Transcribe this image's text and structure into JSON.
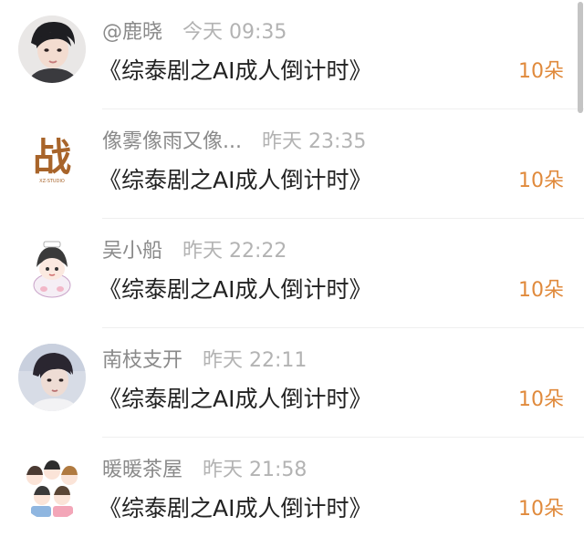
{
  "items": [
    {
      "username": "@鹿晓",
      "time": "今天 09:35",
      "gift": "《综泰剧之AI成人倒计时》",
      "amount": "10朵",
      "avatar_icon": "male-portrait-avatar"
    },
    {
      "username": "像雾像雨又像...",
      "time": "昨天 23:35",
      "gift": "《综泰剧之AI成人倒计时》",
      "amount": "10朵",
      "avatar_icon": "calligraphy-zhan-logo-avatar"
    },
    {
      "username": "吴小船",
      "time": "昨天 22:22",
      "gift": "《综泰剧之AI成人倒计时》",
      "amount": "10朵",
      "avatar_icon": "cartoon-chibi-avatar"
    },
    {
      "username": "南枝支开",
      "time": "昨天 22:11",
      "gift": "《综泰剧之AI成人倒计时》",
      "amount": "10朵",
      "avatar_icon": "male-portrait-avatar"
    },
    {
      "username": "暖暖茶屋",
      "time": "昨天 21:58",
      "gift": "《综泰剧之AI成人倒计时》",
      "amount": "10朵",
      "avatar_icon": "cartoon-group-avatar"
    }
  ],
  "avatar_logo_text": "战",
  "avatar_logo_subtext": "XZ-STUDIO",
  "colors": {
    "amount": "#e08a3c",
    "username": "#8a8a8a",
    "time": "#b3b3b3",
    "gift_text": "#222222",
    "divider": "#efefef"
  }
}
